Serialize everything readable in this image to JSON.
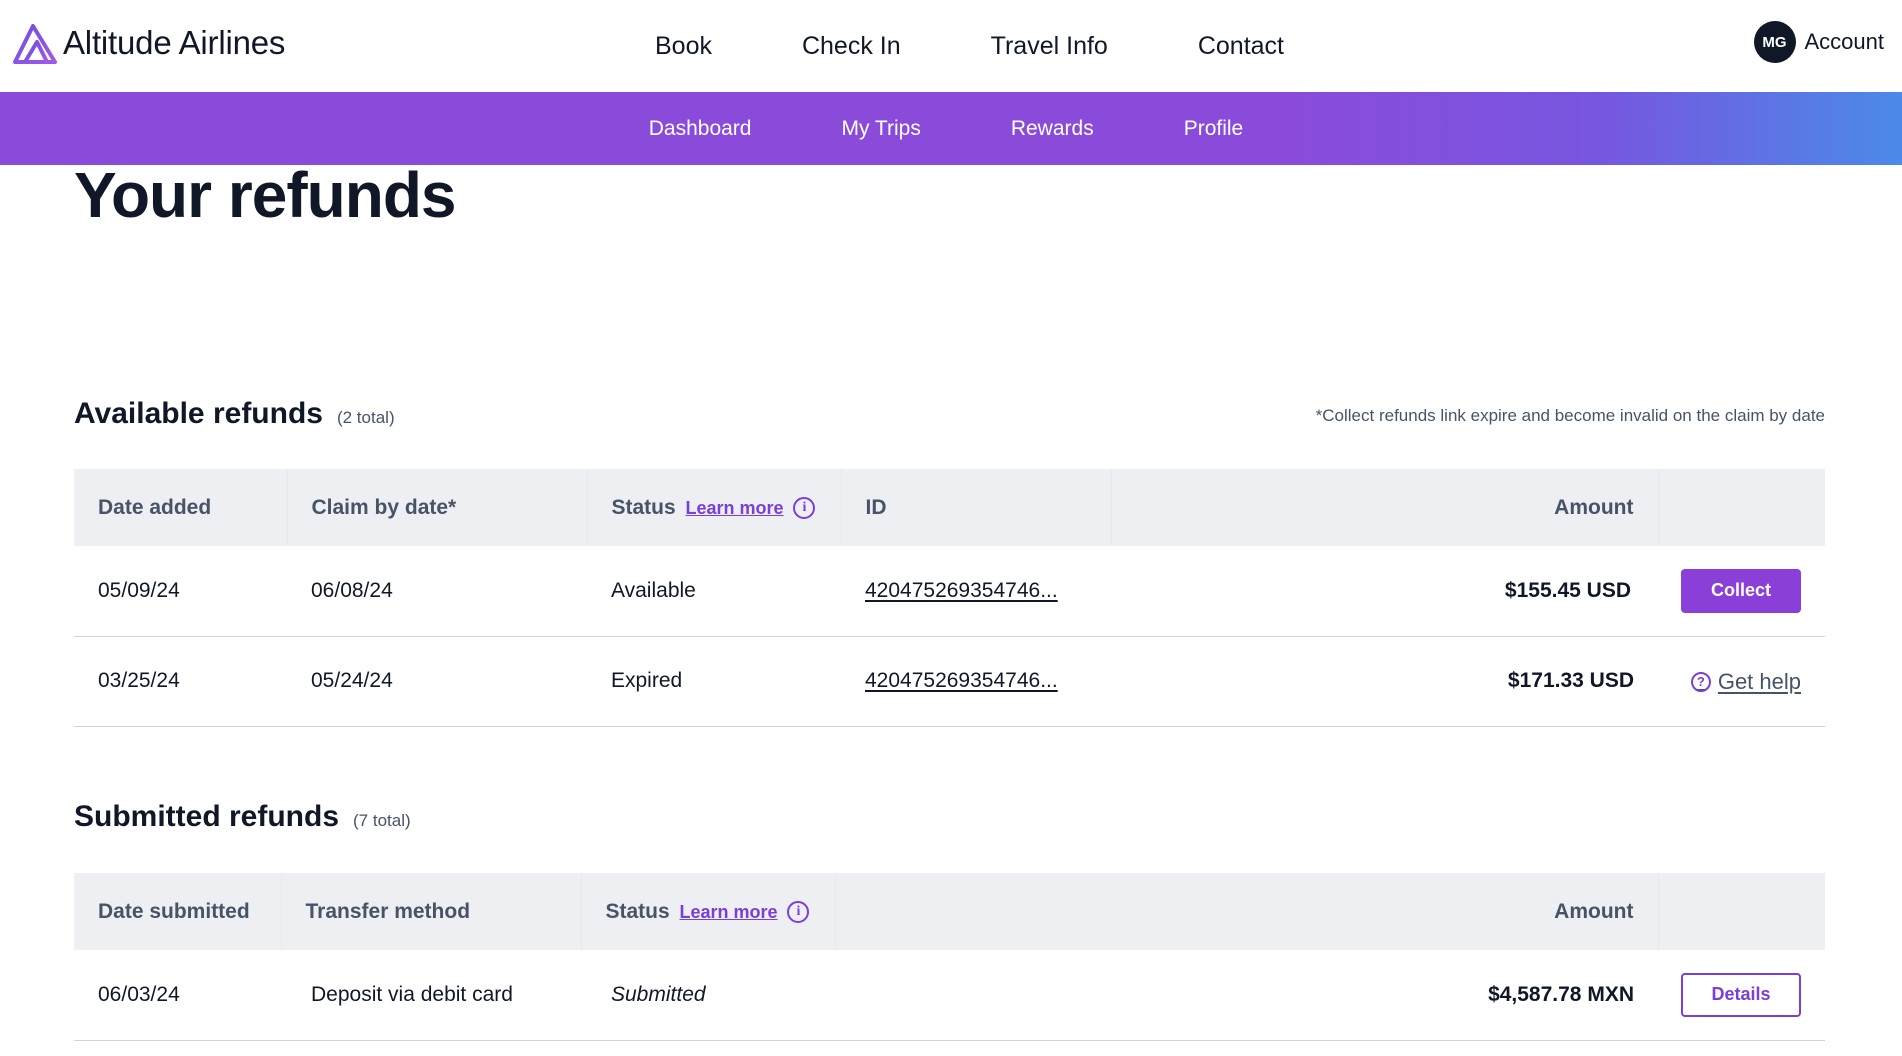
{
  "brand": {
    "name": "Altitude Airlines"
  },
  "main_nav": [
    {
      "label": "Book"
    },
    {
      "label": "Check In"
    },
    {
      "label": "Travel Info"
    },
    {
      "label": "Contact"
    }
  ],
  "account": {
    "initials": "MG",
    "label": "Account"
  },
  "sub_nav": [
    {
      "label": "Dashboard"
    },
    {
      "label": "My Trips"
    },
    {
      "label": "Rewards"
    },
    {
      "label": "Profile"
    }
  ],
  "page_title": "Your refunds",
  "available": {
    "title": "Available refunds",
    "count": "(2 total)",
    "note": "*Collect refunds link expire and become invalid on the claim by date",
    "headers": {
      "date_added": "Date added",
      "claim_by": "Claim by date*",
      "status": "Status",
      "learn_more": "Learn more",
      "id": "ID",
      "amount": "Amount"
    },
    "rows": [
      {
        "date_added": "05/09/24",
        "claim_by": "06/08/24",
        "status": "Available",
        "id": "420475269354746...",
        "amount": "$155.45 USD",
        "action": "Collect"
      },
      {
        "date_added": "03/25/24",
        "claim_by": "05/24/24",
        "status": "Expired",
        "id": "420475269354746...",
        "amount": "$171.33 USD",
        "action": "Get help"
      }
    ]
  },
  "submitted": {
    "title": "Submitted refunds",
    "count": "(7 total)",
    "headers": {
      "date_submitted": "Date submitted",
      "transfer_method": "Transfer method",
      "status": "Status",
      "learn_more": "Learn more",
      "amount": "Amount"
    },
    "rows": [
      {
        "date_submitted": "06/03/24",
        "transfer_method": "Deposit via debit card",
        "status": "Submitted",
        "amount": "$4,587.78 MXN",
        "action": "Details"
      }
    ]
  },
  "colors": {
    "accent": "#8a3fd8",
    "subnav_start": "#8a4bdb",
    "subnav_end": "#4b8ae8",
    "text_dark": "#101828",
    "header_bg": "#eeeff2"
  }
}
